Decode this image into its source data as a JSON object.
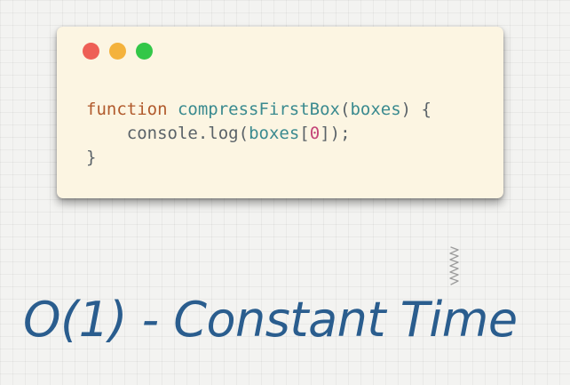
{
  "window": {
    "controls": [
      {
        "name": "close",
        "color": "#ee5f56"
      },
      {
        "name": "minimize",
        "color": "#f4b23c"
      },
      {
        "name": "maximize",
        "color": "#33c748"
      }
    ]
  },
  "code": {
    "line1": {
      "keyword": "function",
      "fn_name": "compressFirstBox",
      "open_paren": "(",
      "param": "boxes",
      "close_paren_brace": ") {"
    },
    "line2": {
      "indent": "    ",
      "object": "console",
      "dot": ".",
      "method": "log",
      "open": "(",
      "arg": "boxes",
      "bracket_open": "[",
      "index": "0",
      "bracket_close": "]",
      "close": ");"
    },
    "line3": {
      "brace": "}"
    }
  },
  "colors": {
    "keyword": "#b15a2c",
    "function_name": "#3a8a8f",
    "identifier": "#5a6268",
    "number": "#c44579",
    "punctuation": "#5a6268",
    "caption": "#2a5d8e"
  },
  "caption": {
    "text": "O(1) - Constant Time"
  }
}
